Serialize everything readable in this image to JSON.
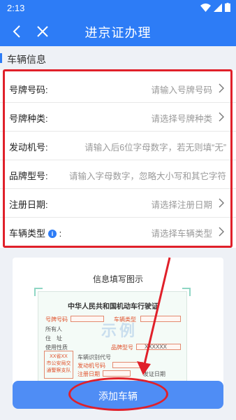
{
  "status_bar": {
    "time": "2:13"
  },
  "app_bar": {
    "title": "进京证办理"
  },
  "section": {
    "title": "车辆信息"
  },
  "form_rows": [
    {
      "label": "号牌号码:",
      "hint": "请输入号牌号码"
    },
    {
      "label": "号牌种类:",
      "hint": "请选择号牌种类"
    },
    {
      "label": "发动机号:",
      "hint": "请输入后6位字母数字，若无则填“无”"
    },
    {
      "label": "品牌型号:",
      "hint": "请输入字母数字，忽略大小写和其它字符"
    },
    {
      "label": "注册日期:",
      "hint": "请选择注册日期"
    },
    {
      "label": "车辆类型",
      "hint": "请选择车辆类型",
      "info_icon": "i",
      "colon": ":"
    }
  ],
  "example_card": {
    "title": "信息填写图示",
    "license_title": "中华人民共和国机动车行驶证",
    "watermark": "示例",
    "fields": {
      "plate_no": "号牌号码",
      "vehicle_type": "车辆类型",
      "owner": "所有人",
      "address": "住　址",
      "use_nature": "使用性质",
      "brand_model": "品牌型号",
      "vin": "车辆识别代号",
      "engine_no": "发动机号码",
      "register_date": "注册日期",
      "issue_date": "发证日期",
      "brand_value": "XXXXXX",
      "stamp": "XX省XX\n市公安局交\n通警察支队"
    }
  },
  "bottom_button": {
    "label": "添加车辆"
  },
  "colors": {
    "primary": "#2d7cf6",
    "annotation_red": "#e0202a",
    "button": "#4f8df5"
  }
}
